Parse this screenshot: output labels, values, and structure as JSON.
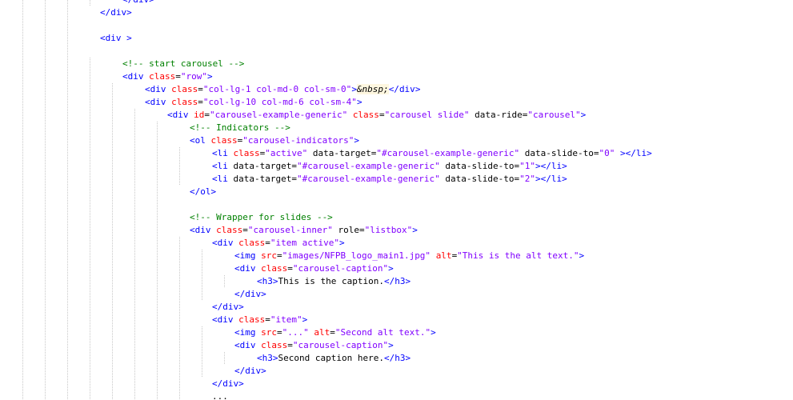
{
  "editor": {
    "lines": [
      {
        "indent": 5,
        "tokens": [
          {
            "t": "tag",
            "v": "</"
          },
          {
            "t": "name",
            "v": "div"
          },
          {
            "t": "tag",
            "v": ">"
          }
        ]
      },
      {
        "indent": 4,
        "tokens": [
          {
            "t": "tag",
            "v": "</"
          },
          {
            "t": "name",
            "v": "div"
          },
          {
            "t": "tag",
            "v": ">"
          }
        ]
      },
      {
        "indent": 0,
        "tokens": []
      },
      {
        "indent": 4,
        "tokens": [
          {
            "t": "tag",
            "v": "<"
          },
          {
            "t": "name",
            "v": "div"
          },
          {
            "t": "plain",
            "v": " "
          },
          {
            "t": "tag",
            "v": ">"
          }
        ]
      },
      {
        "indent": 0,
        "tokens": []
      },
      {
        "indent": 5,
        "tokens": [
          {
            "t": "comment",
            "v": "<!-- start carousel -->"
          }
        ]
      },
      {
        "indent": 5,
        "tokens": [
          {
            "t": "tag",
            "v": "<"
          },
          {
            "t": "name",
            "v": "div"
          },
          {
            "t": "plain",
            "v": " "
          },
          {
            "t": "attr",
            "v": "class"
          },
          {
            "t": "eq",
            "v": "="
          },
          {
            "t": "value",
            "v": "\"row\""
          },
          {
            "t": "tag",
            "v": ">"
          }
        ]
      },
      {
        "indent": 6,
        "tokens": [
          {
            "t": "tag",
            "v": "<"
          },
          {
            "t": "name",
            "v": "div"
          },
          {
            "t": "plain",
            "v": " "
          },
          {
            "t": "attr",
            "v": "class"
          },
          {
            "t": "eq",
            "v": "="
          },
          {
            "t": "value",
            "v": "\"col-lg-1 col-md-0 col-sm-0\""
          },
          {
            "t": "tag",
            "v": ">"
          },
          {
            "t": "entity",
            "v": "&nbsp;"
          },
          {
            "t": "tag",
            "v": "</"
          },
          {
            "t": "name",
            "v": "div"
          },
          {
            "t": "tag",
            "v": ">"
          }
        ]
      },
      {
        "indent": 6,
        "tokens": [
          {
            "t": "tag",
            "v": "<"
          },
          {
            "t": "name",
            "v": "div"
          },
          {
            "t": "plain",
            "v": " "
          },
          {
            "t": "attr",
            "v": "class"
          },
          {
            "t": "eq",
            "v": "="
          },
          {
            "t": "value",
            "v": "\"col-lg-10 col-md-6 col-sm-4\""
          },
          {
            "t": "tag",
            "v": ">"
          }
        ]
      },
      {
        "indent": 7,
        "tokens": [
          {
            "t": "tag",
            "v": "<"
          },
          {
            "t": "name",
            "v": "div"
          },
          {
            "t": "plain",
            "v": " "
          },
          {
            "t": "attr",
            "v": "id"
          },
          {
            "t": "eq",
            "v": "="
          },
          {
            "t": "value",
            "v": "\"carousel-example-generic\""
          },
          {
            "t": "plain",
            "v": " "
          },
          {
            "t": "attr",
            "v": "class"
          },
          {
            "t": "eq",
            "v": "="
          },
          {
            "t": "value",
            "v": "\"carousel slide\""
          },
          {
            "t": "plain",
            "v": " data-ride"
          },
          {
            "t": "eq",
            "v": "="
          },
          {
            "t": "value",
            "v": "\"carousel\""
          },
          {
            "t": "tag",
            "v": ">"
          }
        ]
      },
      {
        "indent": 8,
        "tokens": [
          {
            "t": "comment",
            "v": "<!-- Indicators -->"
          }
        ]
      },
      {
        "indent": 8,
        "tokens": [
          {
            "t": "tag",
            "v": "<"
          },
          {
            "t": "name",
            "v": "ol"
          },
          {
            "t": "plain",
            "v": " "
          },
          {
            "t": "attr",
            "v": "class"
          },
          {
            "t": "eq",
            "v": "="
          },
          {
            "t": "value",
            "v": "\"carousel-indicators\""
          },
          {
            "t": "tag",
            "v": ">"
          }
        ]
      },
      {
        "indent": 9,
        "tokens": [
          {
            "t": "tag",
            "v": "<"
          },
          {
            "t": "name",
            "v": "li"
          },
          {
            "t": "plain",
            "v": " "
          },
          {
            "t": "attr",
            "v": "class"
          },
          {
            "t": "eq",
            "v": "="
          },
          {
            "t": "value",
            "v": "\"active\""
          },
          {
            "t": "plain",
            "v": " data-target"
          },
          {
            "t": "eq",
            "v": "="
          },
          {
            "t": "value",
            "v": "\"#carousel-example-generic\""
          },
          {
            "t": "plain",
            "v": " data-slide-to"
          },
          {
            "t": "eq",
            "v": "="
          },
          {
            "t": "value",
            "v": "\"0\""
          },
          {
            "t": "plain",
            "v": " "
          },
          {
            "t": "tag",
            "v": "></"
          },
          {
            "t": "name",
            "v": "li"
          },
          {
            "t": "tag",
            "v": ">"
          }
        ]
      },
      {
        "indent": 9,
        "tokens": [
          {
            "t": "tag",
            "v": "<"
          },
          {
            "t": "name",
            "v": "li"
          },
          {
            "t": "plain",
            "v": " data-target"
          },
          {
            "t": "eq",
            "v": "="
          },
          {
            "t": "value",
            "v": "\"#carousel-example-generic\""
          },
          {
            "t": "plain",
            "v": " data-slide-to"
          },
          {
            "t": "eq",
            "v": "="
          },
          {
            "t": "value",
            "v": "\"1\""
          },
          {
            "t": "tag",
            "v": "></"
          },
          {
            "t": "name",
            "v": "li"
          },
          {
            "t": "tag",
            "v": ">"
          }
        ]
      },
      {
        "indent": 9,
        "tokens": [
          {
            "t": "tag",
            "v": "<"
          },
          {
            "t": "name",
            "v": "li"
          },
          {
            "t": "plain",
            "v": " data-target"
          },
          {
            "t": "eq",
            "v": "="
          },
          {
            "t": "value",
            "v": "\"#carousel-example-generic\""
          },
          {
            "t": "plain",
            "v": " data-slide-to"
          },
          {
            "t": "eq",
            "v": "="
          },
          {
            "t": "value",
            "v": "\"2\""
          },
          {
            "t": "tag",
            "v": "></"
          },
          {
            "t": "name",
            "v": "li"
          },
          {
            "t": "tag",
            "v": ">"
          }
        ]
      },
      {
        "indent": 8,
        "tokens": [
          {
            "t": "tag",
            "v": "</"
          },
          {
            "t": "name",
            "v": "ol"
          },
          {
            "t": "tag",
            "v": ">"
          }
        ]
      },
      {
        "indent": 0,
        "tokens": []
      },
      {
        "indent": 8,
        "tokens": [
          {
            "t": "comment",
            "v": "<!-- Wrapper for slides -->"
          }
        ]
      },
      {
        "indent": 8,
        "tokens": [
          {
            "t": "tag",
            "v": "<"
          },
          {
            "t": "name",
            "v": "div"
          },
          {
            "t": "plain",
            "v": " "
          },
          {
            "t": "attr",
            "v": "class"
          },
          {
            "t": "eq",
            "v": "="
          },
          {
            "t": "value",
            "v": "\"carousel-inner\""
          },
          {
            "t": "plain",
            "v": " role"
          },
          {
            "t": "eq",
            "v": "="
          },
          {
            "t": "value",
            "v": "\"listbox\""
          },
          {
            "t": "tag",
            "v": ">"
          }
        ]
      },
      {
        "indent": 9,
        "tokens": [
          {
            "t": "tag",
            "v": "<"
          },
          {
            "t": "name",
            "v": "div"
          },
          {
            "t": "plain",
            "v": " "
          },
          {
            "t": "attr",
            "v": "class"
          },
          {
            "t": "eq",
            "v": "="
          },
          {
            "t": "value",
            "v": "\"item active\""
          },
          {
            "t": "tag",
            "v": ">"
          }
        ]
      },
      {
        "indent": 10,
        "tokens": [
          {
            "t": "tag",
            "v": "<"
          },
          {
            "t": "name",
            "v": "img"
          },
          {
            "t": "plain",
            "v": " "
          },
          {
            "t": "attr",
            "v": "src"
          },
          {
            "t": "eq",
            "v": "="
          },
          {
            "t": "value",
            "v": "\"images/NFPB_logo_main1.jpg\""
          },
          {
            "t": "plain",
            "v": " "
          },
          {
            "t": "attr",
            "v": "alt"
          },
          {
            "t": "eq",
            "v": "="
          },
          {
            "t": "value",
            "v": "\"This is the alt text.\""
          },
          {
            "t": "tag",
            "v": ">"
          }
        ]
      },
      {
        "indent": 10,
        "tokens": [
          {
            "t": "tag",
            "v": "<"
          },
          {
            "t": "name",
            "v": "div"
          },
          {
            "t": "plain",
            "v": " "
          },
          {
            "t": "attr",
            "v": "class"
          },
          {
            "t": "eq",
            "v": "="
          },
          {
            "t": "value",
            "v": "\"carousel-caption\""
          },
          {
            "t": "tag",
            "v": ">"
          }
        ]
      },
      {
        "indent": 11,
        "tokens": [
          {
            "t": "tag",
            "v": "<"
          },
          {
            "t": "name",
            "v": "h3"
          },
          {
            "t": "tag",
            "v": ">"
          },
          {
            "t": "text",
            "v": "This is the caption."
          },
          {
            "t": "tag",
            "v": "</"
          },
          {
            "t": "name",
            "v": "h3"
          },
          {
            "t": "tag",
            "v": ">"
          }
        ]
      },
      {
        "indent": 10,
        "tokens": [
          {
            "t": "tag",
            "v": "</"
          },
          {
            "t": "name",
            "v": "div"
          },
          {
            "t": "tag",
            "v": ">"
          }
        ]
      },
      {
        "indent": 9,
        "tokens": [
          {
            "t": "tag",
            "v": "</"
          },
          {
            "t": "name",
            "v": "div"
          },
          {
            "t": "tag",
            "v": ">"
          }
        ]
      },
      {
        "indent": 9,
        "tokens": [
          {
            "t": "tag",
            "v": "<"
          },
          {
            "t": "name",
            "v": "div"
          },
          {
            "t": "plain",
            "v": " "
          },
          {
            "t": "attr",
            "v": "class"
          },
          {
            "t": "eq",
            "v": "="
          },
          {
            "t": "value",
            "v": "\"item\""
          },
          {
            "t": "tag",
            "v": ">"
          }
        ]
      },
      {
        "indent": 10,
        "tokens": [
          {
            "t": "tag",
            "v": "<"
          },
          {
            "t": "name",
            "v": "img"
          },
          {
            "t": "plain",
            "v": " "
          },
          {
            "t": "attr",
            "v": "src"
          },
          {
            "t": "eq",
            "v": "="
          },
          {
            "t": "value",
            "v": "\"...\""
          },
          {
            "t": "plain",
            "v": " "
          },
          {
            "t": "attr",
            "v": "alt"
          },
          {
            "t": "eq",
            "v": "="
          },
          {
            "t": "value",
            "v": "\"Second alt text.\""
          },
          {
            "t": "tag",
            "v": ">"
          }
        ]
      },
      {
        "indent": 10,
        "tokens": [
          {
            "t": "tag",
            "v": "<"
          },
          {
            "t": "name",
            "v": "div"
          },
          {
            "t": "plain",
            "v": " "
          },
          {
            "t": "attr",
            "v": "class"
          },
          {
            "t": "eq",
            "v": "="
          },
          {
            "t": "value",
            "v": "\"carousel-caption\""
          },
          {
            "t": "tag",
            "v": ">"
          }
        ]
      },
      {
        "indent": 11,
        "tokens": [
          {
            "t": "tag",
            "v": "<"
          },
          {
            "t": "name",
            "v": "h3"
          },
          {
            "t": "tag",
            "v": ">"
          },
          {
            "t": "text",
            "v": "Second caption here."
          },
          {
            "t": "tag",
            "v": "</"
          },
          {
            "t": "name",
            "v": "h3"
          },
          {
            "t": "tag",
            "v": ">"
          }
        ]
      },
      {
        "indent": 10,
        "tokens": [
          {
            "t": "tag",
            "v": "</"
          },
          {
            "t": "name",
            "v": "div"
          },
          {
            "t": "tag",
            "v": ">"
          }
        ]
      },
      {
        "indent": 9,
        "tokens": [
          {
            "t": "tag",
            "v": "</"
          },
          {
            "t": "name",
            "v": "div"
          },
          {
            "t": "tag",
            "v": ">"
          }
        ]
      },
      {
        "indent": 9,
        "tokens": [
          {
            "t": "text",
            "v": "..."
          }
        ]
      }
    ]
  },
  "colors": {
    "tag": "#0000ff",
    "attr": "#ff0000",
    "value": "#8000ff",
    "comment": "#008000",
    "text": "#000000",
    "entity_highlight": "#fef7e0",
    "indent_guide": "#c8c8c8"
  }
}
